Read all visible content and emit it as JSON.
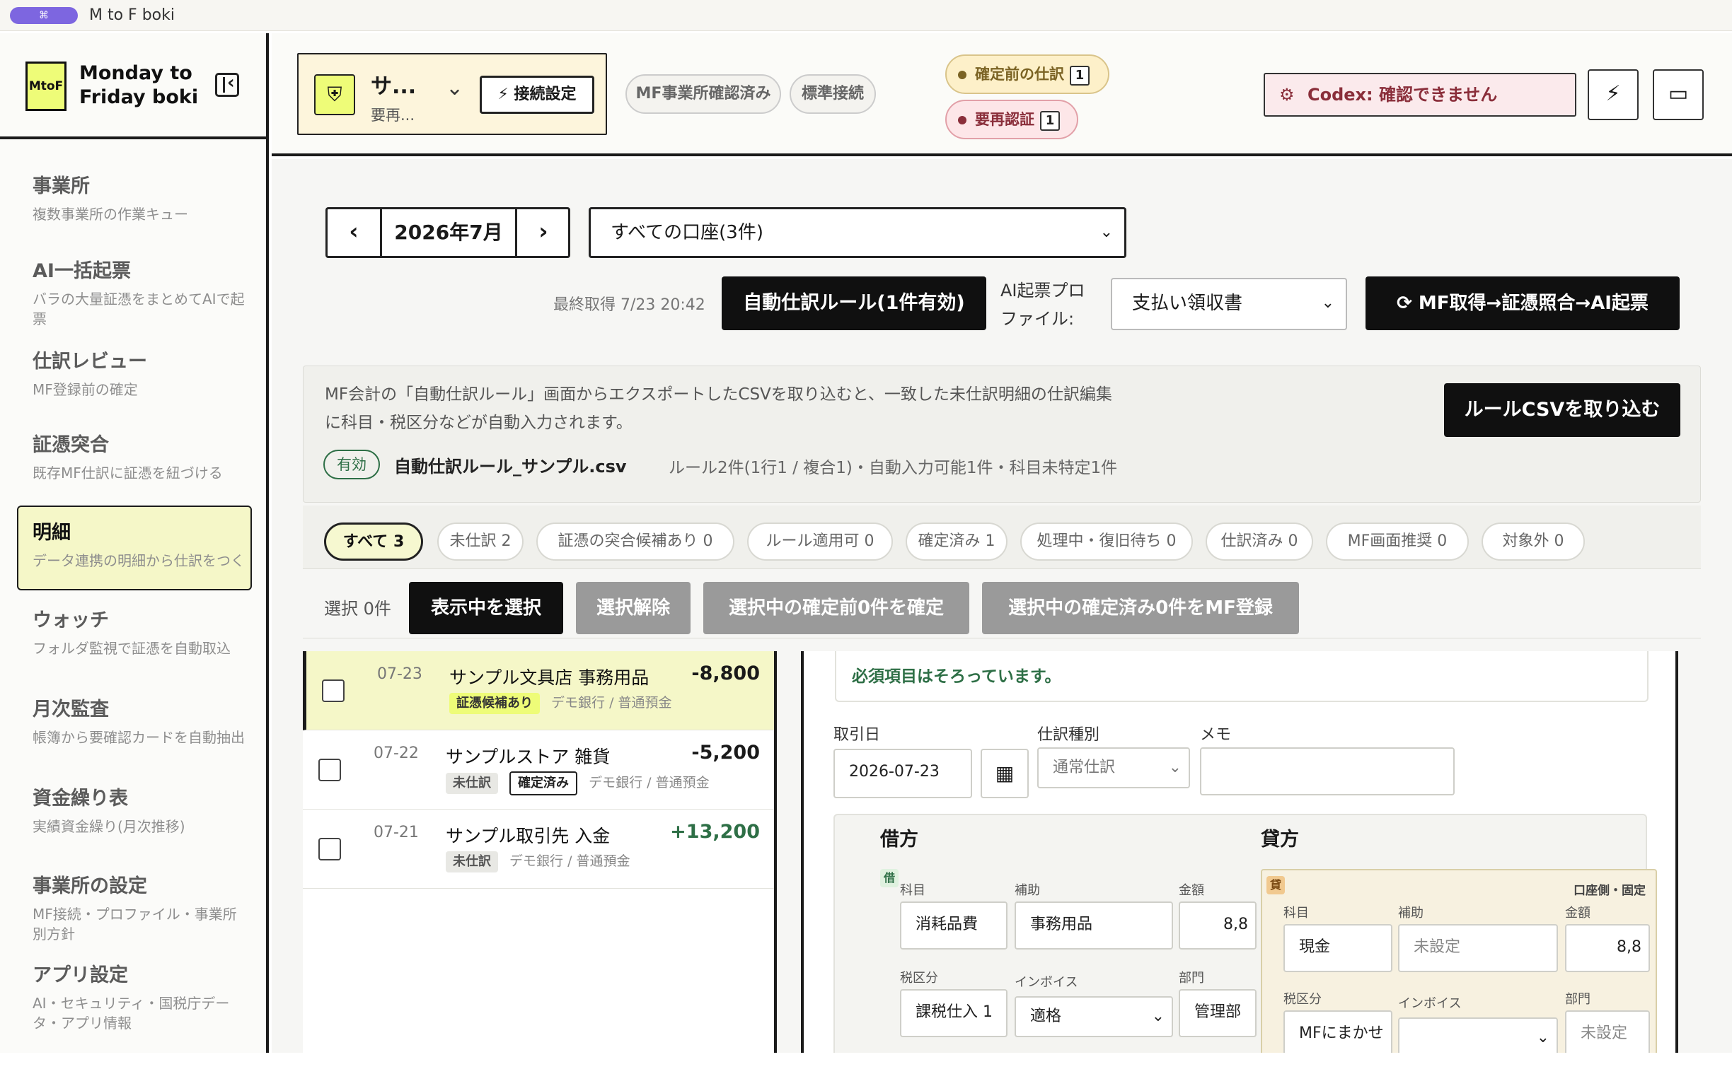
{
  "window": {
    "badge_icon": "command-icon",
    "title": "M to F boki"
  },
  "brand": {
    "logo": "MtoF",
    "name_line1": "Monday to",
    "name_line2": "Friday boki"
  },
  "nav": [
    {
      "title": "事業所",
      "desc": "複数事業所の作業キュー"
    },
    {
      "title": "AI一括起票",
      "desc": "バラの大量証憑をまとめてAIで起票"
    },
    {
      "title": "仕訳レビュー",
      "desc": "MF登録前の確定"
    },
    {
      "title": "証憑突合",
      "desc": "既存MF仕訳に証憑を紐づける"
    },
    {
      "title": "明細",
      "desc": "データ連携の明細から仕訳をつくる"
    },
    {
      "title": "ウォッチ",
      "desc": "フォルダ監視で証憑を自動取込"
    },
    {
      "title": "月次監査",
      "desc": "帳簿から要確認カードを自動抽出"
    },
    {
      "title": "資金繰り表",
      "desc": "実績資金繰り(月次推移)"
    },
    {
      "title": "事業所の設定",
      "desc": "MF接続・プロファイル・事業所別方針"
    },
    {
      "title": "アプリ設定",
      "desc": "AI・セキュリティ・国税庁データ・アプリ情報"
    }
  ],
  "header": {
    "office_name": "サ...",
    "office_sub": "要再...",
    "connect_button": "接続設定",
    "tag_mf": "MF事業所確認済み",
    "tag_std": "標準接続",
    "chip_pending": {
      "label": "確定前の仕訳",
      "count": "1"
    },
    "chip_reauth": {
      "label": "要再認証",
      "count": "1"
    },
    "codex_status": "Codex: 確認できません",
    "colors": {
      "accent": "#eefc78",
      "warn": "#8a2e3a",
      "ok": "#2e6f46"
    }
  },
  "toolbar": {
    "prev": "‹",
    "month": "2026年7月",
    "next": "›",
    "account_select": "すべての口座(3件)",
    "last_fetch": "最終取得 7/23 20:42",
    "rule_button": "自動仕訳ルール(1件有効)",
    "profile_label_1": "AI起票プロ",
    "profile_label_2": "ファイル:",
    "profile_select": "支払い領収書",
    "run_button": "MF取得→証憑照合→AI起票"
  },
  "rules": {
    "desc_line1": "MF会計の「自動仕訳ルール」画面からエクスポートしたCSVを取り込むと、一致した未仕訳明細の仕訳編集",
    "desc_line2": "に科目・税区分などが自動入力されます。",
    "import_button": "ルールCSVを取り込む",
    "status": "有効",
    "file": "自動仕訳ルール_サンプル.csv",
    "stats": "ルール2件(1行1 / 複合1)・自動入力可能1件・科目未特定1件"
  },
  "filters": [
    "すべて 3",
    "未仕訳 2",
    "証憑の突合候補あり 0",
    "ルール適用可 0",
    "確定済み 1",
    "処理中・復旧待ち 0",
    "仕訳済み 0",
    "MF画面推奨 0",
    "対象外 0"
  ],
  "selection": {
    "count": "選択 0件",
    "select_visible": "表示中を選択",
    "clear": "選択解除",
    "confirm": "選択中の確定前0件を確定",
    "register": "選択中の確定済み0件をMF登録"
  },
  "transactions": [
    {
      "date": "07-23",
      "name": "サンプル文具店 事務用品",
      "amount": "-8,800",
      "badges": [
        "証憑候補あり"
      ],
      "account": "デモ銀行 / 普通預金"
    },
    {
      "date": "07-22",
      "name": "サンプルストア 雑貨",
      "amount": "-5,200",
      "badges": [
        "未仕訳",
        "確定済み"
      ],
      "account": "デモ銀行 / 普通預金"
    },
    {
      "date": "07-21",
      "name": "サンプル取引先 入金",
      "amount": "+13,200",
      "badges": [
        "未仕訳"
      ],
      "account": "デモ銀行 / 普通預金"
    }
  ],
  "detail": {
    "ok_message": "必須項目はそろっています。",
    "date_label": "取引日",
    "date_value": "2026-07-23",
    "type_label": "仕訳種別",
    "type_value": "通常仕訳",
    "memo_label": "メモ",
    "debit_header": "借方",
    "credit_header": "貸方",
    "debit_badge": "借",
    "credit_badge": "貸",
    "credit_note": "口座側・固定",
    "labels": {
      "account": "科目",
      "sub": "補助",
      "amount": "金額",
      "tax": "税区分",
      "invoice": "インボイス",
      "dept": "部門"
    },
    "debit": {
      "account": "消耗品費",
      "sub": "事務用品",
      "amount": "8,8",
      "tax": "課税仕入 1",
      "invoice": "適格",
      "dept": "管理部"
    },
    "credit": {
      "account": "現金",
      "sub": "未設定",
      "amount": "8,8",
      "tax": "MFにまかせ",
      "invoice": "",
      "dept": "未設定"
    }
  }
}
